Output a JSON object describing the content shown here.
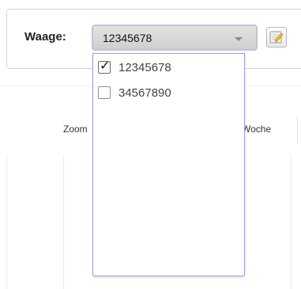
{
  "filter": {
    "label": "Waage:",
    "selected_value": "12345678",
    "edit_icon": "edit-note-icon"
  },
  "dropdown": {
    "options": [
      {
        "label": "12345678",
        "checked": true
      },
      {
        "label": "34567890",
        "checked": false
      }
    ],
    "check_glyph": "✓"
  },
  "chart": {
    "zoom_label": "Zoom",
    "woche_label": "Woche"
  },
  "colors": {
    "dropdown_border": "#9c9ce0",
    "select_bg": "#d8d8d8"
  }
}
